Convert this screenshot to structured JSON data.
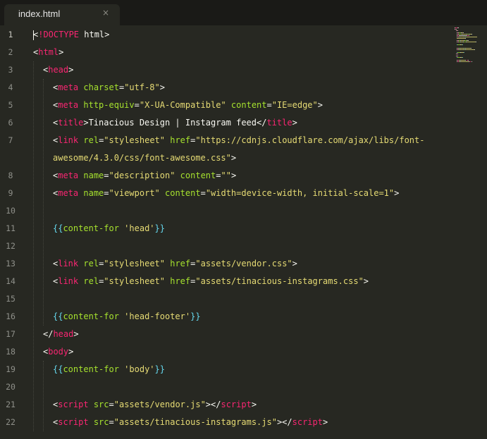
{
  "tab": {
    "label": "index.html",
    "close_glyph": "×",
    "close_icon": "close-icon"
  },
  "editor": {
    "active_line": 1
  },
  "lines": [
    {
      "n": "1",
      "indent": 0,
      "tokens": [
        {
          "c": "tx",
          "t": "<"
        },
        {
          "c": "tg",
          "t": "!DOCTYPE"
        },
        {
          "c": "tx",
          "t": " html>"
        }
      ]
    },
    {
      "n": "2",
      "indent": 0,
      "tokens": [
        {
          "c": "tx",
          "t": "<"
        },
        {
          "c": "tg",
          "t": "html"
        },
        {
          "c": "tx",
          "t": ">"
        }
      ]
    },
    {
      "n": "3",
      "indent": 1,
      "tokens": [
        {
          "c": "tx",
          "t": "<"
        },
        {
          "c": "tg",
          "t": "head"
        },
        {
          "c": "tx",
          "t": ">"
        }
      ]
    },
    {
      "n": "4",
      "indent": 2,
      "tokens": [
        {
          "c": "tx",
          "t": "<"
        },
        {
          "c": "tg",
          "t": "meta"
        },
        {
          "c": "tx",
          "t": " "
        },
        {
          "c": "at",
          "t": "charset"
        },
        {
          "c": "tx",
          "t": "="
        },
        {
          "c": "st",
          "t": "\"utf-8\""
        },
        {
          "c": "tx",
          "t": ">"
        }
      ]
    },
    {
      "n": "5",
      "indent": 2,
      "tokens": [
        {
          "c": "tx",
          "t": "<"
        },
        {
          "c": "tg",
          "t": "meta"
        },
        {
          "c": "tx",
          "t": " "
        },
        {
          "c": "at",
          "t": "http-equiv"
        },
        {
          "c": "tx",
          "t": "="
        },
        {
          "c": "st",
          "t": "\"X-UA-Compatible\""
        },
        {
          "c": "tx",
          "t": " "
        },
        {
          "c": "at",
          "t": "content"
        },
        {
          "c": "tx",
          "t": "="
        },
        {
          "c": "st",
          "t": "\"IE=edge\""
        },
        {
          "c": "tx",
          "t": ">"
        }
      ]
    },
    {
      "n": "6",
      "indent": 2,
      "tokens": [
        {
          "c": "tx",
          "t": "<"
        },
        {
          "c": "tg",
          "t": "title"
        },
        {
          "c": "tx",
          "t": ">Tinacious Design | Instagram feed</"
        },
        {
          "c": "tg",
          "t": "title"
        },
        {
          "c": "tx",
          "t": ">"
        }
      ]
    },
    {
      "n": "7",
      "indent": 2,
      "tokens": [
        {
          "c": "tx",
          "t": "<"
        },
        {
          "c": "tg",
          "t": "link"
        },
        {
          "c": "tx",
          "t": " "
        },
        {
          "c": "at",
          "t": "rel"
        },
        {
          "c": "tx",
          "t": "="
        },
        {
          "c": "st",
          "t": "\"stylesheet\""
        },
        {
          "c": "tx",
          "t": " "
        },
        {
          "c": "at",
          "t": "href"
        },
        {
          "c": "tx",
          "t": "="
        },
        {
          "c": "st",
          "t": "\"https://cdnjs.cloudflare.com/ajax/libs/font-"
        }
      ]
    },
    {
      "n": "",
      "indent": 2,
      "tokens": [
        {
          "c": "st",
          "t": "awesome/4.3.0/css/font-awesome.css\""
        },
        {
          "c": "tx",
          "t": ">"
        }
      ]
    },
    {
      "n": "8",
      "indent": 2,
      "tokens": [
        {
          "c": "tx",
          "t": "<"
        },
        {
          "c": "tg",
          "t": "meta"
        },
        {
          "c": "tx",
          "t": " "
        },
        {
          "c": "at",
          "t": "name"
        },
        {
          "c": "tx",
          "t": "="
        },
        {
          "c": "st",
          "t": "\"description\""
        },
        {
          "c": "tx",
          "t": " "
        },
        {
          "c": "at",
          "t": "content"
        },
        {
          "c": "tx",
          "t": "="
        },
        {
          "c": "st",
          "t": "\"\""
        },
        {
          "c": "tx",
          "t": ">"
        }
      ]
    },
    {
      "n": "9",
      "indent": 2,
      "tokens": [
        {
          "c": "tx",
          "t": "<"
        },
        {
          "c": "tg",
          "t": "meta"
        },
        {
          "c": "tx",
          "t": " "
        },
        {
          "c": "at",
          "t": "name"
        },
        {
          "c": "tx",
          "t": "="
        },
        {
          "c": "st",
          "t": "\"viewport\""
        },
        {
          "c": "tx",
          "t": " "
        },
        {
          "c": "at",
          "t": "content"
        },
        {
          "c": "tx",
          "t": "="
        },
        {
          "c": "st",
          "t": "\"width=device-width, initial-scale=1\""
        },
        {
          "c": "tx",
          "t": ">"
        }
      ]
    },
    {
      "n": "10",
      "indent": 2,
      "tokens": []
    },
    {
      "n": "11",
      "indent": 2,
      "tokens": [
        {
          "c": "hb",
          "t": "{{"
        },
        {
          "c": "at",
          "t": "content-for"
        },
        {
          "c": "tx",
          "t": " "
        },
        {
          "c": "st",
          "t": "'head'"
        },
        {
          "c": "hb",
          "t": "}}"
        }
      ]
    },
    {
      "n": "12",
      "indent": 2,
      "tokens": []
    },
    {
      "n": "13",
      "indent": 2,
      "tokens": [
        {
          "c": "tx",
          "t": "<"
        },
        {
          "c": "tg",
          "t": "link"
        },
        {
          "c": "tx",
          "t": " "
        },
        {
          "c": "at",
          "t": "rel"
        },
        {
          "c": "tx",
          "t": "="
        },
        {
          "c": "st",
          "t": "\"stylesheet\""
        },
        {
          "c": "tx",
          "t": " "
        },
        {
          "c": "at",
          "t": "href"
        },
        {
          "c": "tx",
          "t": "="
        },
        {
          "c": "st",
          "t": "\"assets/vendor.css\""
        },
        {
          "c": "tx",
          "t": ">"
        }
      ]
    },
    {
      "n": "14",
      "indent": 2,
      "tokens": [
        {
          "c": "tx",
          "t": "<"
        },
        {
          "c": "tg",
          "t": "link"
        },
        {
          "c": "tx",
          "t": " "
        },
        {
          "c": "at",
          "t": "rel"
        },
        {
          "c": "tx",
          "t": "="
        },
        {
          "c": "st",
          "t": "\"stylesheet\""
        },
        {
          "c": "tx",
          "t": " "
        },
        {
          "c": "at",
          "t": "href"
        },
        {
          "c": "tx",
          "t": "="
        },
        {
          "c": "st",
          "t": "\"assets/tinacious-instagrams.css\""
        },
        {
          "c": "tx",
          "t": ">"
        }
      ]
    },
    {
      "n": "15",
      "indent": 2,
      "tokens": []
    },
    {
      "n": "16",
      "indent": 2,
      "tokens": [
        {
          "c": "hb",
          "t": "{{"
        },
        {
          "c": "at",
          "t": "content-for"
        },
        {
          "c": "tx",
          "t": " "
        },
        {
          "c": "st",
          "t": "'head-footer'"
        },
        {
          "c": "hb",
          "t": "}}"
        }
      ]
    },
    {
      "n": "17",
      "indent": 1,
      "tokens": [
        {
          "c": "tx",
          "t": "</"
        },
        {
          "c": "tg",
          "t": "head"
        },
        {
          "c": "tx",
          "t": ">"
        }
      ]
    },
    {
      "n": "18",
      "indent": 1,
      "tokens": [
        {
          "c": "tx",
          "t": "<"
        },
        {
          "c": "tg",
          "t": "body"
        },
        {
          "c": "tx",
          "t": ">"
        }
      ]
    },
    {
      "n": "19",
      "indent": 2,
      "tokens": [
        {
          "c": "hb",
          "t": "{{"
        },
        {
          "c": "at",
          "t": "content-for"
        },
        {
          "c": "tx",
          "t": " "
        },
        {
          "c": "st",
          "t": "'body'"
        },
        {
          "c": "hb",
          "t": "}}"
        }
      ]
    },
    {
      "n": "20",
      "indent": 2,
      "tokens": []
    },
    {
      "n": "21",
      "indent": 2,
      "tokens": [
        {
          "c": "tx",
          "t": "<"
        },
        {
          "c": "tg",
          "t": "script"
        },
        {
          "c": "tx",
          "t": " "
        },
        {
          "c": "at",
          "t": "src"
        },
        {
          "c": "tx",
          "t": "="
        },
        {
          "c": "st",
          "t": "\"assets/vendor.js\""
        },
        {
          "c": "tx",
          "t": "></"
        },
        {
          "c": "tg",
          "t": "script"
        },
        {
          "c": "tx",
          "t": ">"
        }
      ]
    },
    {
      "n": "22",
      "indent": 2,
      "tokens": [
        {
          "c": "tx",
          "t": "<"
        },
        {
          "c": "tg",
          "t": "script"
        },
        {
          "c": "tx",
          "t": " "
        },
        {
          "c": "at",
          "t": "src"
        },
        {
          "c": "tx",
          "t": "="
        },
        {
          "c": "st",
          "t": "\"assets/tinacious-instagrams.js\""
        },
        {
          "c": "tx",
          "t": "></"
        },
        {
          "c": "tg",
          "t": "script"
        },
        {
          "c": "tx",
          "t": ">"
        }
      ]
    }
  ],
  "theme": {
    "background": "#272822",
    "tag": "#f92672",
    "attribute": "#a6e22e",
    "string": "#e6db74",
    "handlebars": "#66d9ef",
    "text": "#f8f8f2",
    "gutter_text": "#8f908a"
  }
}
